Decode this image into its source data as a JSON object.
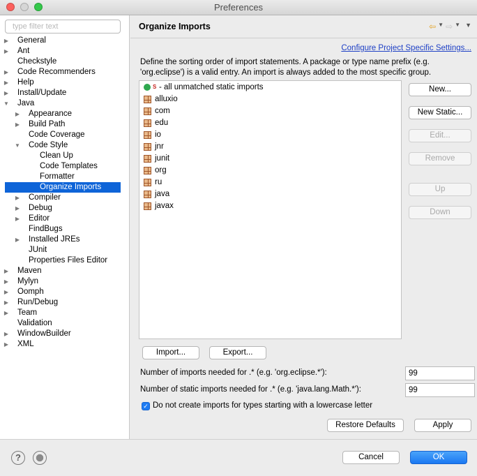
{
  "window": {
    "title": "Preferences"
  },
  "sidebar": {
    "filter_placeholder": "type filter text",
    "items": [
      {
        "label": "General",
        "level": 0,
        "expandable": true,
        "expanded": false
      },
      {
        "label": "Ant",
        "level": 0,
        "expandable": true,
        "expanded": false
      },
      {
        "label": "Checkstyle",
        "level": 0,
        "expandable": false
      },
      {
        "label": "Code Recommenders",
        "level": 0,
        "expandable": true,
        "expanded": false
      },
      {
        "label": "Help",
        "level": 0,
        "expandable": true,
        "expanded": false
      },
      {
        "label": "Install/Update",
        "level": 0,
        "expandable": true,
        "expanded": false
      },
      {
        "label": "Java",
        "level": 0,
        "expandable": true,
        "expanded": true
      },
      {
        "label": "Appearance",
        "level": 1,
        "expandable": true,
        "expanded": false
      },
      {
        "label": "Build Path",
        "level": 1,
        "expandable": true,
        "expanded": false
      },
      {
        "label": "Code Coverage",
        "level": 1,
        "expandable": false
      },
      {
        "label": "Code Style",
        "level": 1,
        "expandable": true,
        "expanded": true
      },
      {
        "label": "Clean Up",
        "level": 2,
        "expandable": false
      },
      {
        "label": "Code Templates",
        "level": 2,
        "expandable": false
      },
      {
        "label": "Formatter",
        "level": 2,
        "expandable": false
      },
      {
        "label": "Organize Imports",
        "level": 2,
        "expandable": false,
        "selected": true
      },
      {
        "label": "Compiler",
        "level": 1,
        "expandable": true,
        "expanded": false
      },
      {
        "label": "Debug",
        "level": 1,
        "expandable": true,
        "expanded": false
      },
      {
        "label": "Editor",
        "level": 1,
        "expandable": true,
        "expanded": false
      },
      {
        "label": "FindBugs",
        "level": 1,
        "expandable": false
      },
      {
        "label": "Installed JREs",
        "level": 1,
        "expandable": true,
        "expanded": false
      },
      {
        "label": "JUnit",
        "level": 1,
        "expandable": false
      },
      {
        "label": "Properties Files Editor",
        "level": 1,
        "expandable": false
      },
      {
        "label": "Maven",
        "level": 0,
        "expandable": true,
        "expanded": false
      },
      {
        "label": "Mylyn",
        "level": 0,
        "expandable": true,
        "expanded": false
      },
      {
        "label": "Oomph",
        "level": 0,
        "expandable": true,
        "expanded": false
      },
      {
        "label": "Run/Debug",
        "level": 0,
        "expandable": true,
        "expanded": false
      },
      {
        "label": "Team",
        "level": 0,
        "expandable": true,
        "expanded": false
      },
      {
        "label": "Validation",
        "level": 0,
        "expandable": false
      },
      {
        "label": "WindowBuilder",
        "level": 0,
        "expandable": true,
        "expanded": false
      },
      {
        "label": "XML",
        "level": 0,
        "expandable": true,
        "expanded": false
      }
    ]
  },
  "main": {
    "title": "Organize Imports",
    "config_link": "Configure Project Specific Settings...",
    "description": "Define the sorting order of import statements. A package or type name prefix (e.g. 'org.eclipse') is a valid entry. An import is always added to the most specific group.",
    "import_groups": [
      {
        "label": "- all unmatched static imports",
        "kind": "static"
      },
      {
        "label": "alluxio",
        "kind": "package"
      },
      {
        "label": "com",
        "kind": "package"
      },
      {
        "label": "edu",
        "kind": "package"
      },
      {
        "label": "io",
        "kind": "package"
      },
      {
        "label": "jnr",
        "kind": "package"
      },
      {
        "label": "junit",
        "kind": "package"
      },
      {
        "label": "org",
        "kind": "package"
      },
      {
        "label": "ru",
        "kind": "package"
      },
      {
        "label": "java",
        "kind": "package"
      },
      {
        "label": "javax",
        "kind": "package"
      }
    ],
    "buttons": {
      "new": "New...",
      "new_static": "New Static...",
      "edit": "Edit...",
      "remove": "Remove",
      "up": "Up",
      "down": "Down",
      "import": "Import...",
      "export": "Export...",
      "restore_defaults": "Restore Defaults",
      "apply": "Apply"
    },
    "imports_threshold_label": "Number of imports needed for .* (e.g. 'org.eclipse.*'):",
    "imports_threshold_value": "99",
    "static_threshold_label": "Number of static imports needed for .* (e.g. 'java.lang.Math.*'):",
    "static_threshold_value": "99",
    "lowercase_checkbox_label": "Do not create imports for types starting with a lowercase letter",
    "lowercase_checkbox_checked": true
  },
  "footer": {
    "cancel": "Cancel",
    "ok": "OK"
  },
  "colors": {
    "selection": "#0e64d8",
    "link": "#1d3fc5",
    "primary_button": "#1a78f2"
  },
  "icons": {
    "static_import": "static-import-icon",
    "package": "package-icon",
    "help": "help-icon",
    "back": "back-arrow-icon",
    "forward": "forward-arrow-icon",
    "menu": "menu-icon"
  }
}
